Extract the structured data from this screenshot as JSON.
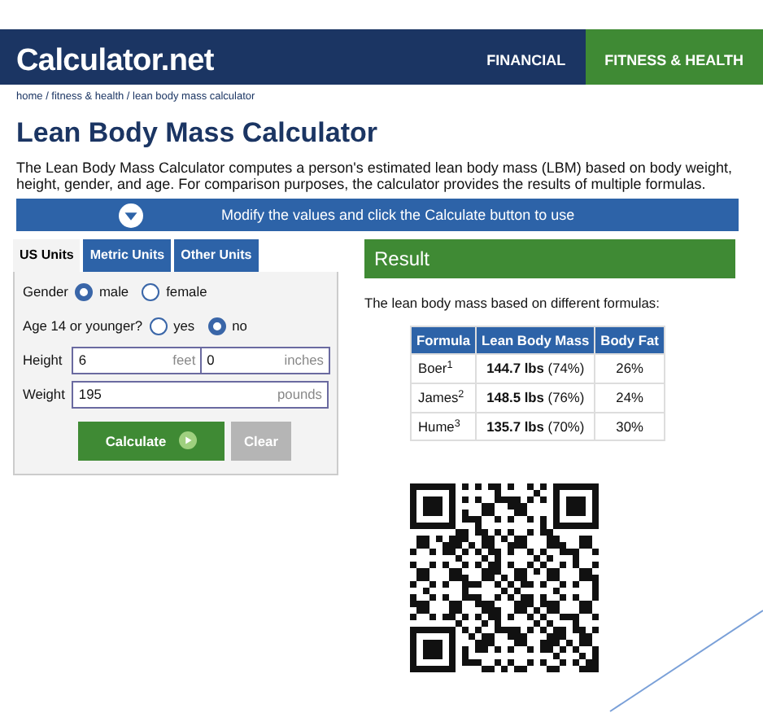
{
  "header": {
    "logo": "Calculator.net",
    "nav": [
      {
        "label": "FINANCIAL",
        "selected": false
      },
      {
        "label": "FITNESS & HEALTH",
        "selected": true
      }
    ]
  },
  "breadcrumb": "home / fitness & health / lean body mass calculator",
  "title": "Lean Body Mass Calculator",
  "description": "The Lean Body Mass Calculator computes a person's estimated lean body mass (LBM) based on body weight, height, gender, and age. For comparison purposes, the calculator provides the results of multiple formulas.",
  "banner": "Modify the values and click the Calculate button to use",
  "unit_tabs": [
    {
      "label": "US Units",
      "selected": true
    },
    {
      "label": "Metric Units",
      "selected": false
    },
    {
      "label": "Other Units",
      "selected": false
    }
  ],
  "form": {
    "gender": {
      "label": "Gender",
      "options": [
        {
          "label": "male",
          "selected": true
        },
        {
          "label": "female",
          "selected": false
        }
      ]
    },
    "age": {
      "label": "Age 14 or younger?",
      "options": [
        {
          "label": "yes",
          "selected": false
        },
        {
          "label": "no",
          "selected": true
        }
      ]
    },
    "height": {
      "label": "Height",
      "fields": [
        {
          "value": "6",
          "unit": "feet"
        },
        {
          "value": "0",
          "unit": "inches"
        }
      ]
    },
    "weight": {
      "label": "Weight",
      "value": "195",
      "unit": "pounds"
    },
    "buttons": [
      {
        "label": "Calculate",
        "kind": "primary"
      },
      {
        "label": "Clear",
        "kind": "secondary"
      }
    ]
  },
  "result": {
    "title": "Result",
    "caption": "The lean body mass based on different formulas:",
    "columns": [
      "Formula",
      "Lean Body Mass",
      "Body Fat"
    ],
    "rows": [
      [
        "Boer$^{1}$",
        "**144.7 lbs** (74%)",
        "26%"
      ],
      [
        "James$^{2}$",
        "**148.5 lbs** (76%)",
        "24%"
      ],
      [
        "Hume$^{3}$",
        "**135.7 lbs** (70%)",
        "30%"
      ]
    ]
  }
}
